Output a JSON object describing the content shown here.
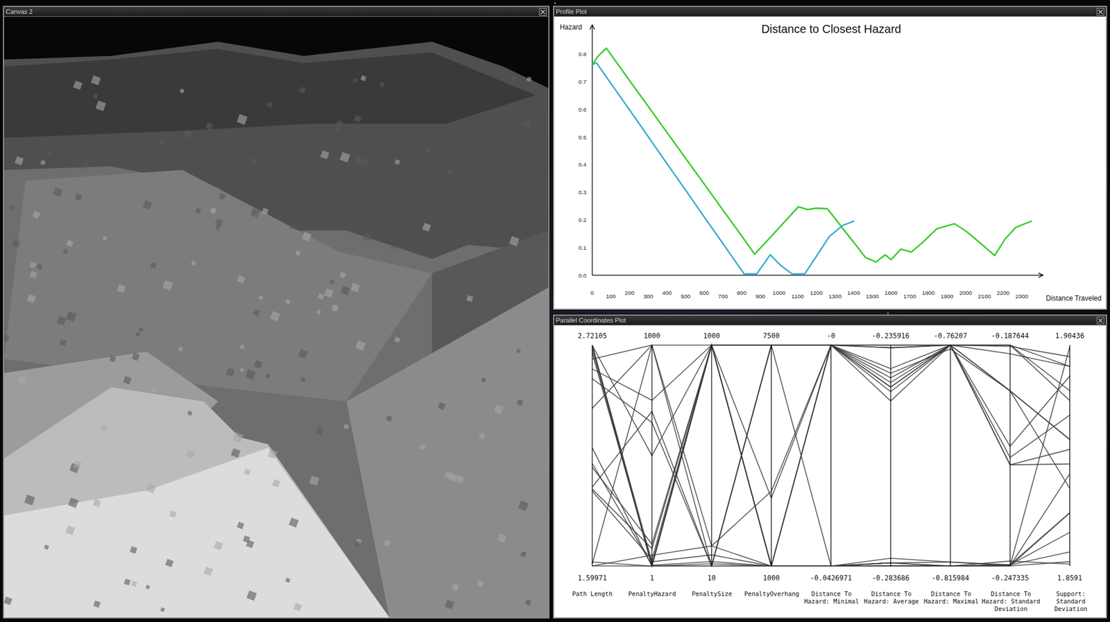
{
  "windows": {
    "canvas": {
      "title": "Canvas 2"
    },
    "profile": {
      "title": "Profile Plot",
      "chart": {
        "title": "Distance to Closest Hazard",
        "y_label": "Hazard",
        "x_label": "Distance Traveled",
        "y_ticks": [
          "0.0",
          "0.1",
          "0.2",
          "0.3",
          "0.4",
          "0.5",
          "0.6",
          "0.7",
          "0.8"
        ],
        "x_ticks": [
          "0",
          "100",
          "200",
          "300",
          "400",
          "500",
          "600",
          "700",
          "800",
          "900",
          "1000",
          "1100",
          "1200",
          "1300",
          "1400",
          "1500",
          "1600",
          "1700",
          "1800",
          "1900",
          "2000",
          "2100",
          "2200",
          "2300"
        ],
        "series": [
          {
            "color": "#38cc2c",
            "x": [
              0,
              30,
              75,
              100,
              200,
              321,
              400,
              500,
              600,
              700,
              800,
              870,
              950,
              1030,
              1104,
              1153,
              1200,
              1259,
              1300,
              1360,
              1420,
              1463,
              1520,
              1569,
              1600,
              1652,
              1709,
              1780,
              1845,
              1940,
              2000,
              2080,
              2155,
              2210,
              2268,
              2355
            ],
            "y": [
              0.76,
              0.79,
              0.82,
              0.797,
              0.703,
              0.59,
              0.516,
              0.422,
              0.329,
              0.235,
              0.142,
              0.076,
              0.134,
              0.193,
              0.247,
              0.237,
              0.242,
              0.24,
              0.205,
              0.153,
              0.102,
              0.064,
              0.048,
              0.074,
              0.056,
              0.094,
              0.084,
              0.125,
              0.168,
              0.186,
              0.16,
              0.115,
              0.071,
              0.13,
              0.173,
              0.196
            ]
          },
          {
            "color": "#3aaed0",
            "x": [
              0,
              23,
              100,
              197,
              300,
              400,
              500,
              600,
              700,
              813,
              881,
              953,
              1010,
              1070,
              1138,
              1200,
              1270,
              1342,
              1403
            ],
            "y": [
              0.76,
              0.767,
              0.693,
              0.6,
              0.5,
              0.403,
              0.307,
              0.21,
              0.114,
              0.005,
              0.005,
              0.074,
              0.035,
              0.005,
              0.005,
              0.068,
              0.14,
              0.18,
              0.196
            ]
          }
        ]
      }
    },
    "parallel": {
      "title": "Parallel Coordinates Plot",
      "axes": [
        {
          "name": "Path Length",
          "max": "2.72105",
          "min": "1.59971"
        },
        {
          "name": "PenaltyHazard",
          "max": "1000",
          "min": "1"
        },
        {
          "name": "PenaltySize",
          "max": "1000",
          "min": "10"
        },
        {
          "name": "PenaltyOverhang",
          "max": "7500",
          "min": "1000"
        },
        {
          "name": "Distance To Hazard: Minimal",
          "max": "-0",
          "min": "-0.0426971"
        },
        {
          "name": "Distance To Hazard: Average",
          "max": "-0.235916",
          "min": "-0.283686"
        },
        {
          "name": "Distance To Hazard: Maximal",
          "max": "-0.76207",
          "min": "-0.815984"
        },
        {
          "name": "Distance To Hazard: Standard Deviation",
          "max": "-0.187644",
          "min": "-0.247335"
        },
        {
          "name": "Support: Standard Deviation",
          "max": "1.90436",
          "min": "1.8591"
        }
      ],
      "records": [
        [
          2.72,
          1,
          1000,
          1000,
          -0.0427,
          -0.2837,
          -0.816,
          -0.2473,
          1.904
        ],
        [
          2.7,
          1,
          1000,
          7500,
          0,
          -0.2359,
          -0.762,
          -0.1876,
          1.895
        ],
        [
          2.65,
          1000,
          10,
          1000,
          -0.0427,
          -0.283,
          -0.815,
          -0.247,
          1.87
        ],
        [
          2.6,
          750,
          1000,
          7500,
          0,
          -0.245,
          -0.762,
          -0.22,
          1.88
        ],
        [
          2.55,
          650,
          10,
          1000,
          0,
          -0.242,
          -0.763,
          -0.2,
          1.885
        ],
        [
          2.1,
          100,
          1000,
          1000,
          -0.0427,
          -0.283,
          -0.816,
          -0.247,
          1.862
        ],
        [
          1.6,
          50,
          100,
          3200,
          0,
          -0.245,
          -0.762,
          -0.218,
          1.89
        ],
        [
          2.2,
          1,
          10,
          7500,
          0,
          -0.2365,
          -0.762,
          -0.1876,
          1.9
        ],
        [
          1.98,
          30,
          1000,
          1000,
          -0.0427,
          -0.2837,
          -0.816,
          -0.247,
          1.866
        ],
        [
          1.61,
          1000,
          1000,
          7500,
          0,
          -0.248,
          -0.762,
          -0.2,
          1.875
        ],
        [
          2.72,
          20,
          60,
          1000,
          -0.0427,
          -0.282,
          -0.815,
          -0.2473,
          1.86
        ],
        [
          1.62,
          1,
          10,
          7500,
          0,
          -0.244,
          -0.762,
          -0.215,
          1.898
        ],
        [
          2.68,
          10,
          1000,
          3000,
          0,
          -0.241,
          -0.762,
          -0.2,
          1.885
        ],
        [
          2.12,
          5,
          30,
          1000,
          -0.0427,
          -0.2836,
          -0.8159,
          -0.2473,
          1.87
        ],
        [
          2.72,
          500,
          1000,
          7500,
          0,
          -0.243,
          -0.762,
          -0.19,
          1.9
        ],
        [
          1.6,
          1,
          1000,
          1000,
          -0.0427,
          -0.283,
          -0.816,
          -0.246,
          1.8595
        ],
        [
          2.0,
          700,
          10,
          7500,
          0,
          -0.2365,
          -0.762,
          -0.1876,
          1.893
        ],
        [
          2.72,
          1,
          20,
          1000,
          0,
          -0.2359,
          -0.762,
          -0.188,
          1.902
        ],
        [
          1.99,
          80,
          1000,
          7500,
          -0.0427,
          -0.2837,
          -0.816,
          -0.2473,
          1.878
        ],
        [
          2.4,
          1000,
          100,
          1000,
          0,
          -0.246,
          -0.762,
          -0.22,
          1.883
        ]
      ]
    }
  }
}
